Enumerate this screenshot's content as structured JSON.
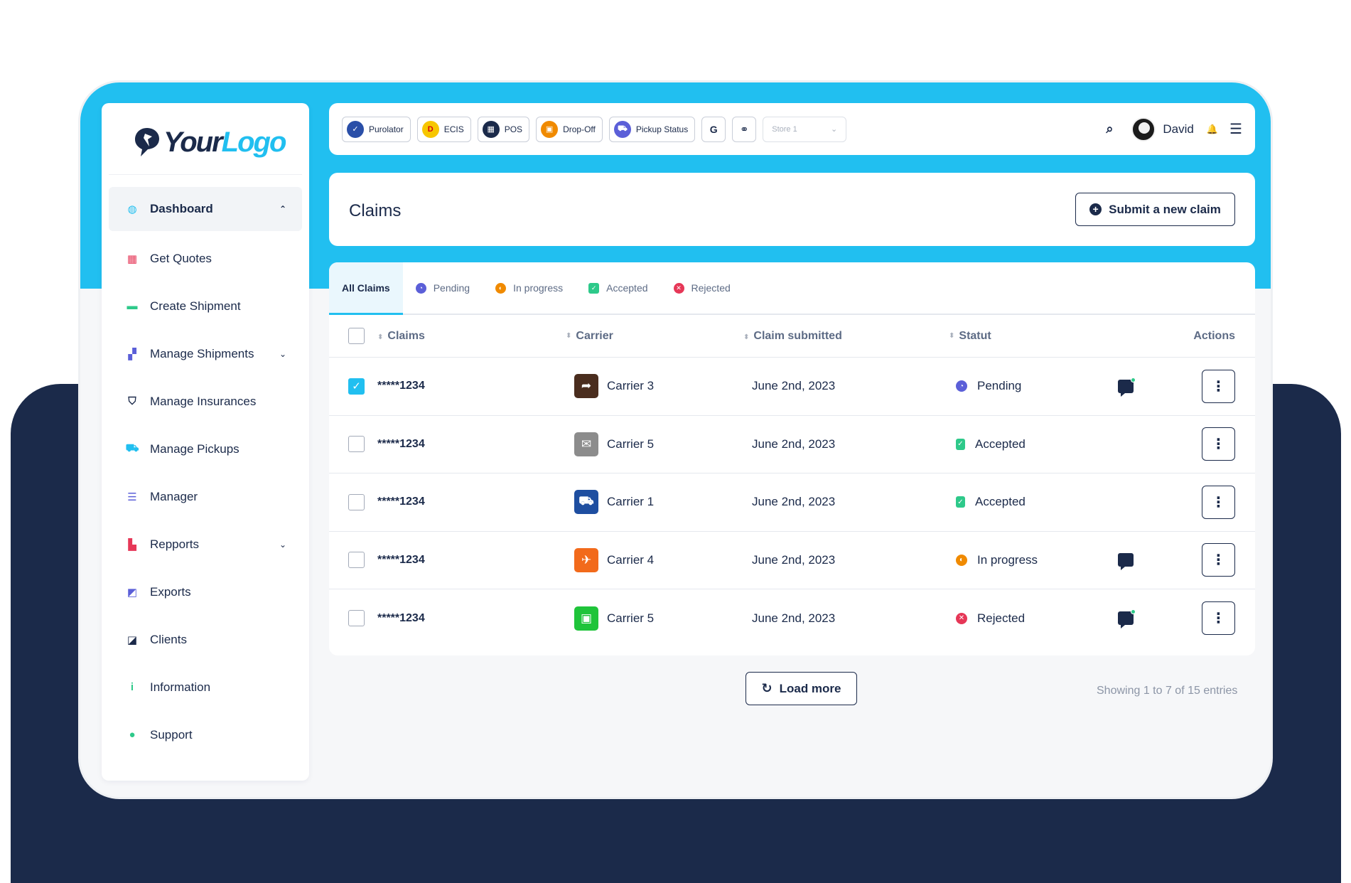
{
  "logo": {
    "part1": "Your",
    "part2": "Logo"
  },
  "sidebar": {
    "items": [
      {
        "label": "Dashboard",
        "icon": "dashboard-icon",
        "color": "#21bff0",
        "glyph": "◍",
        "active": true,
        "chevron": "⌃"
      },
      {
        "label": "Get Quotes",
        "icon": "calculator-icon",
        "color": "#e63757",
        "glyph": "▦"
      },
      {
        "label": "Create Shipment",
        "icon": "package-icon",
        "color": "#2ec98a",
        "glyph": "▬"
      },
      {
        "label": "Manage Shipments",
        "icon": "boxes-icon",
        "color": "#5b5fd8",
        "glyph": "▞",
        "chevron": "⌄"
      },
      {
        "label": "Manage Insurances",
        "icon": "basket-icon",
        "color": "#1b2a4a",
        "glyph": "⛉"
      },
      {
        "label": "Manage Pickups",
        "icon": "dolly-icon",
        "color": "#21bff0",
        "glyph": "⛟"
      },
      {
        "label": "Manager",
        "icon": "tasks-icon",
        "color": "#5b5fd8",
        "glyph": "☰"
      },
      {
        "label": "Repports",
        "icon": "bar-chart-icon",
        "color": "#e63757",
        "glyph": "▙",
        "chevron": "⌄"
      },
      {
        "label": "Exports",
        "icon": "share-icon",
        "color": "#5b5fd8",
        "glyph": "◩"
      },
      {
        "label": "Clients",
        "icon": "share-square-icon",
        "color": "#1b2a4a",
        "glyph": "◪"
      },
      {
        "label": "Information",
        "icon": "info-icon",
        "color": "#2ec98a",
        "glyph": "i"
      },
      {
        "label": "Support",
        "icon": "chat-bubble-icon",
        "color": "#2ec98a",
        "glyph": "●"
      }
    ]
  },
  "topbar": {
    "buttons": [
      {
        "label": "Purolator",
        "color": "#2a4fa8",
        "glyph": "✓"
      },
      {
        "label": "ECIS",
        "color": "#f7c600",
        "glyph": "D"
      },
      {
        "label": "POS",
        "color": "#1b2a4a",
        "glyph": "▦"
      },
      {
        "label": "Drop-Off",
        "color": "#f08a00",
        "glyph": "▣"
      },
      {
        "label": "Pickup Status",
        "color": "#5b5fd8",
        "glyph": "⛟"
      }
    ],
    "g_label": "G",
    "link_glyph": "⚭",
    "store": {
      "value": "Store 1",
      "chevron": "⌄"
    },
    "search_glyph": "⌕",
    "username": "David",
    "bell_glyph": "🔔",
    "menu_glyph": "☰"
  },
  "header": {
    "title": "Claims",
    "submit_label": "Submit a new claim",
    "plus_glyph": "+"
  },
  "tabs": [
    {
      "label": "All Claims",
      "active": true
    },
    {
      "label": "Pending",
      "color": "#5b5fd8",
      "glyph": "◔"
    },
    {
      "label": "In progress",
      "color": "#f08a00",
      "glyph": "◐"
    },
    {
      "label": "Accepted",
      "color": "#2ec98a",
      "glyph": "✓"
    },
    {
      "label": "Rejected",
      "color": "#e63757",
      "glyph": "✕"
    }
  ],
  "table": {
    "columns": {
      "claims": "Claims",
      "carrier": "Carrier",
      "submitted": "Claim submitted",
      "status": "Statut",
      "actions": "Actions"
    },
    "sort_glyph": "⬍",
    "rows": [
      {
        "claim": "*****1234",
        "carrier": "Carrier 3",
        "carrier_color": "#4a2d1e",
        "carrier_glyph": "➦",
        "date": "June 2nd, 2023",
        "status": "Pending",
        "status_color": "#5b5fd8",
        "status_glyph": "◔",
        "checked": true,
        "chat": true,
        "chat_dot": true
      },
      {
        "claim": "*****1234",
        "carrier": "Carrier 5",
        "carrier_color": "#8c8c8c",
        "carrier_glyph": "✉",
        "date": "June 2nd, 2023",
        "status": "Accepted",
        "status_color": "#2ec98a",
        "status_glyph": "✓",
        "checked": false,
        "chat": false
      },
      {
        "claim": "*****1234",
        "carrier": "Carrier 1",
        "carrier_color": "#1e4ea0",
        "carrier_glyph": "⛟",
        "date": "June 2nd, 2023",
        "status": "Accepted",
        "status_color": "#2ec98a",
        "status_glyph": "✓",
        "checked": false,
        "chat": false
      },
      {
        "claim": "*****1234",
        "carrier": "Carrier 4",
        "carrier_color": "#f26a1b",
        "carrier_glyph": "✈",
        "date": "June 2nd, 2023",
        "status": "In progress",
        "status_color": "#f08a00",
        "status_glyph": "◐",
        "checked": false,
        "chat": true,
        "chat_dot": false
      },
      {
        "claim": "*****1234",
        "carrier": "Carrier 5",
        "carrier_color": "#1fc43a",
        "carrier_glyph": "▣",
        "date": "June 2nd, 2023",
        "status": "Rejected",
        "status_color": "#e63757",
        "status_glyph": "✕",
        "checked": false,
        "chat": true,
        "chat_dot": true
      }
    ],
    "kebab_glyph": "⋮",
    "check_glyph": "✓"
  },
  "footer": {
    "load_more": "Load more",
    "refresh_glyph": "↻",
    "showing": "Showing 1 to 7 of 15 entries"
  }
}
